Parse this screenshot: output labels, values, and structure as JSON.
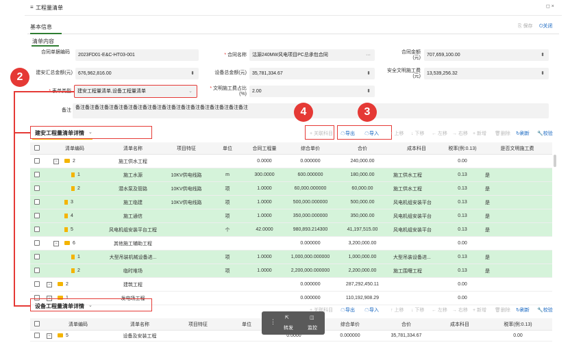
{
  "window": {
    "title": "工程量清单",
    "menu_icon": "hamburger-icon",
    "ctrl": "◻ ×"
  },
  "tabs": [
    "基本信息"
  ],
  "actions": {
    "save": "保存",
    "close": "关闭"
  },
  "section": {
    "title": "清单内容"
  },
  "form": {
    "contract_code": {
      "label": "合同单据编码",
      "value": "2023FD01-E&C-HT03-001"
    },
    "contract_name": {
      "label": "合同名称",
      "value": "沽源240MW风电项目PC总承包合同",
      "more": "···"
    },
    "contract_amount": {
      "label": "合同金额(元)",
      "value": "707,659,100.00"
    },
    "construction_total": {
      "label": "建安汇总金额(元)",
      "value": "676,962,816.00"
    },
    "equipment_total": {
      "label": "设备总金额(元)",
      "value": "35,781,334.67"
    },
    "safety_fee": {
      "label": "安全文明施工费(元)",
      "value": "13,539,256.32"
    },
    "form_type": {
      "label": "表单类型",
      "value": "建安工程量清单,设备工程量清单"
    },
    "civil_ratio": {
      "label": "文明施工费占比(%)",
      "value": "2.00"
    },
    "remark": {
      "label": "备注",
      "value": "备注备注备注备注备注备注备注备注备注备注备注备注备注备注备注备注备注备注"
    }
  },
  "badges": [
    "2",
    "4",
    "3"
  ],
  "detail1": {
    "title": "建安工程量清单详情",
    "toolbar": [
      "+ 关联科目",
      "导出",
      "导入",
      "↑ 上移",
      "↓ 下移",
      "← 左移",
      "→ 右移",
      "+ 新增",
      "删除",
      "刷新",
      "校验"
    ],
    "headers": [
      "",
      "清单编码",
      "清单名称",
      "项目特征",
      "单位",
      "合同工程量",
      "综合单价",
      "合价",
      "成本科目",
      "税率(例:0.13)",
      "是否文明施工费"
    ],
    "rows": [
      {
        "expand": "⊟",
        "icon": "folder",
        "code": "2",
        "name": "施工供水工程",
        "feature": "",
        "unit": "",
        "qty": "0.0000",
        "price": "0.000000",
        "total": "240,000.00",
        "subject": "",
        "tax": "0.00",
        "civil": "",
        "green": false,
        "indent": 1
      },
      {
        "expand": "",
        "icon": "file",
        "code": "1",
        "name": "施工水源",
        "feature": "10KV供电线路",
        "unit": "m",
        "qty": "300.0000",
        "price": "600.000000",
        "total": "180,000.00",
        "subject": "施工供水工程",
        "tax": "0.13",
        "civil": "是",
        "green": true,
        "indent": 2
      },
      {
        "expand": "",
        "icon": "file",
        "code": "2",
        "name": "潜水泵及管路",
        "feature": "10KV供电线路",
        "unit": "项",
        "qty": "1.0000",
        "price": "60,000.000000",
        "total": "60,000.00",
        "subject": "施工供水工程",
        "tax": "0.13",
        "civil": "是",
        "green": true,
        "indent": 2
      },
      {
        "expand": "",
        "icon": "file",
        "code": "3",
        "name": "施工临建",
        "feature": "10KV供电线路",
        "unit": "项",
        "qty": "1.0000",
        "price": "500,000.000000",
        "total": "500,000.00",
        "subject": "风电机组安装平台",
        "tax": "0.13",
        "civil": "是",
        "green": true,
        "indent": 1
      },
      {
        "expand": "",
        "icon": "file",
        "code": "4",
        "name": "施工通信",
        "feature": "",
        "unit": "项",
        "qty": "1.0000",
        "price": "350,000.000000",
        "total": "350,000.00",
        "subject": "风电机组安装平台",
        "tax": "0.13",
        "civil": "是",
        "green": true,
        "indent": 1
      },
      {
        "expand": "",
        "icon": "file",
        "code": "5",
        "name": "风电机组安装平台工程",
        "feature": "",
        "unit": "个",
        "qty": "42.0000",
        "price": "980,893.214300",
        "total": "41,197,515.00",
        "subject": "风电机组安装平台",
        "tax": "0.13",
        "civil": "是",
        "green": true,
        "indent": 1
      },
      {
        "expand": "⊟",
        "icon": "folder",
        "code": "6",
        "name": "其他施工辅助工程",
        "feature": "",
        "unit": "",
        "qty": "",
        "price": "0.000000",
        "total": "3,200,000.00",
        "subject": "",
        "tax": "0.00",
        "civil": "",
        "green": false,
        "indent": 1
      },
      {
        "expand": "",
        "icon": "file",
        "code": "1",
        "name": "大型吊装机械设备进...",
        "feature": "",
        "unit": "项",
        "qty": "1.0000",
        "price": "1,000,000.000000",
        "total": "1,000,000.00",
        "subject": "大型吊装设备进...",
        "tax": "0.13",
        "civil": "是",
        "green": true,
        "indent": 2
      },
      {
        "expand": "",
        "icon": "file",
        "code": "2",
        "name": "临时堆场",
        "feature": "",
        "unit": "项",
        "qty": "1.0000",
        "price": "2,200,000.000000",
        "total": "2,200,000.00",
        "subject": "施工围堰工程",
        "tax": "0.13",
        "civil": "是",
        "green": true,
        "indent": 2
      },
      {
        "expand": "⊟",
        "icon": "folder",
        "code": "2",
        "name": "建筑工程",
        "feature": "",
        "unit": "",
        "qty": "",
        "price": "0.000000",
        "total": "287,292,450.11",
        "subject": "",
        "tax": "0.00",
        "civil": "",
        "green": false,
        "indent": 0
      },
      {
        "expand": "⊟",
        "icon": "folder",
        "code": "1",
        "name": "发电场工程",
        "feature": "",
        "unit": "",
        "qty": "",
        "price": "0.000000",
        "total": "110,192,908.29",
        "subject": "",
        "tax": "0.00",
        "civil": "",
        "green": false,
        "indent": 0
      }
    ]
  },
  "detail2": {
    "title": "设备工程量清单详情",
    "toolbar": [
      "+ 关联科目",
      "导出",
      "导入",
      "↑ 上移",
      "↓ 下移",
      "← 左移",
      "→ 右移",
      "+ 新增",
      "删除",
      "刷新",
      "校验"
    ],
    "headers": [
      "",
      "清单编码",
      "清单名称",
      "项目特征",
      "单位",
      "合同工程量",
      "综合单价",
      "合价",
      "成本科目",
      "税率(例:0.13)"
    ],
    "rows": [
      {
        "expand": "⊟",
        "icon": "folder",
        "code": "5",
        "name": "设备及安装工程",
        "feature": "",
        "unit": "",
        "qty": "0.0000",
        "price": "0.000000",
        "total": "35,781,334.67",
        "subject": "",
        "tax": "0.00"
      }
    ]
  },
  "popup": {
    "menu": "⋮",
    "forward": "转发",
    "monitor": "监控"
  }
}
